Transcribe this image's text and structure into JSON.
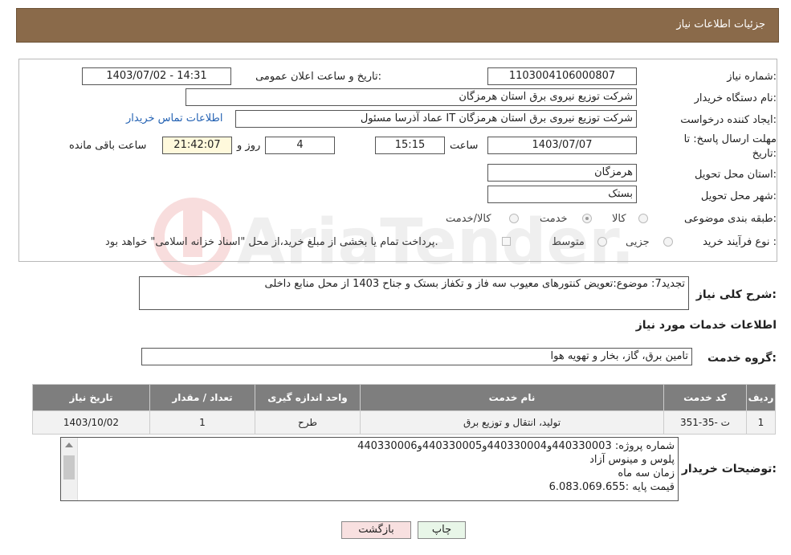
{
  "header": {
    "title": "جزئیات اطلاعات نیاز"
  },
  "form": {
    "need_number_label": "شماره نیاز:",
    "need_number": "1103004106000807",
    "announce_label": "تاریخ و ساعت اعلان عمومی:",
    "announce_value": "1403/07/02 - 14:31",
    "buyer_org_label": "نام دستگاه خریدار:",
    "buyer_org": "شرکت توزیع نیروی برق استان هرمزگان",
    "creator_label": "ایجاد کننده درخواست:",
    "creator": "عماد آذرسا مسئول IT شرکت توزیع نیروی برق استان هرمزگان",
    "contact_link": "اطلاعات تماس خریدار",
    "deadline_label_1": "مهلت ارسال پاسخ: تا",
    "deadline_label_2": "تاریخ:",
    "deadline_date": "1403/07/07",
    "time_label": "ساعت",
    "deadline_time": "15:15",
    "days_value": "4",
    "days_label": "روز و",
    "remaining_time": "21:42:07",
    "remaining_label": "ساعت باقی مانده",
    "province_label": "استان محل تحویل:",
    "province": "هرمزگان",
    "city_label": "شهر محل تحویل:",
    "city": "بستک",
    "category_label": "طبقه بندی موضوعی:",
    "category_options": [
      "کالا",
      "خدمت",
      "کالا/خدمت"
    ],
    "category_selected": "خدمت",
    "purchase_type_label": "نوع فرآیند خرید :",
    "purchase_options": [
      "جزیی",
      "متوسط"
    ],
    "payment_note": "پرداخت تمام یا بخشی از مبلغ خرید،از محل \"اسناد خزانه اسلامی\" خواهد بود."
  },
  "description": {
    "label": "شرح کلی نیاز:",
    "text": "تجدید7: موضوع:تعویض کنتورهای معیوب سه فاز و تکفاز بستک و جناح 1403 از محل منابع داخلی"
  },
  "services": {
    "section_title": "اطلاعات خدمات مورد نیاز",
    "group_label": "گروه خدمت:",
    "group_value": "تامین برق، گاز، بخار و تهویه هوا",
    "columns": [
      "ردیف",
      "کد خدمت",
      "نام خدمت",
      "واحد اندازه گیری",
      "تعداد / مقدار",
      "تاریخ نیاز"
    ],
    "rows": [
      [
        "1",
        "ت -35-351",
        "تولید، انتقال و توزیع برق",
        "طرح",
        "1",
        "1403/10/02"
      ]
    ]
  },
  "buyer_notes": {
    "label": "توضیحات خریدار:",
    "lines": [
      "شماره پروژه:  440330003و440330004و440330005و440330006",
      " پلوس و مینوس آزاد",
      "زمان سه ماه",
      "قیمت پایه :6.083.069.655"
    ]
  },
  "buttons": {
    "print": "چاپ",
    "back": "بازگشت"
  },
  "watermark": "AriaTender.neT"
}
